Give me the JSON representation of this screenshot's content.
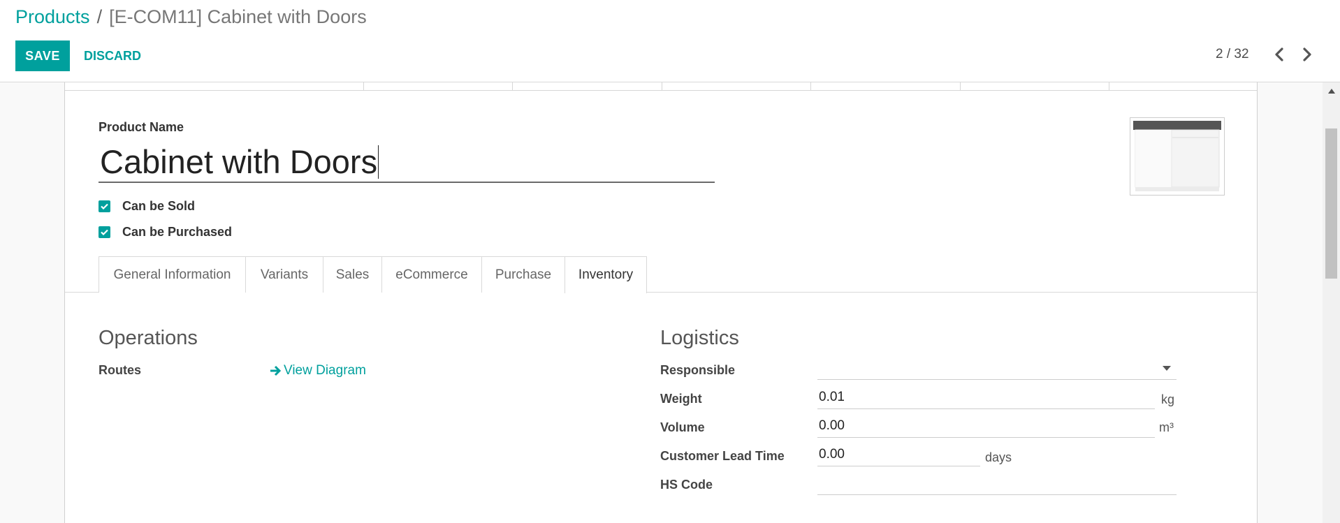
{
  "breadcrumb": {
    "parent": "Products",
    "separator": "/",
    "current": "[E-COM11] Cabinet with Doors"
  },
  "toolbar": {
    "save_label": "SAVE",
    "discard_label": "DISCARD"
  },
  "pager": {
    "value": "2 / 32"
  },
  "form": {
    "product_name_label": "Product Name",
    "product_name": "Cabinet with Doors",
    "checkboxes": [
      {
        "label": "Can be Sold",
        "checked": true
      },
      {
        "label": "Can be Purchased",
        "checked": true
      }
    ]
  },
  "tabs": [
    {
      "label": "General Information",
      "active": false
    },
    {
      "label": "Variants",
      "active": false
    },
    {
      "label": "Sales",
      "active": false
    },
    {
      "label": "eCommerce",
      "active": false
    },
    {
      "label": "Purchase",
      "active": false
    },
    {
      "label": "Inventory",
      "active": true
    }
  ],
  "operations": {
    "title": "Operations",
    "routes_label": "Routes",
    "view_diagram_label": "View Diagram"
  },
  "logistics": {
    "title": "Logistics",
    "responsible_label": "Responsible",
    "responsible_value": "",
    "weight_label": "Weight",
    "weight_value": "0.01",
    "weight_unit": "kg",
    "volume_label": "Volume",
    "volume_value": "0.00",
    "volume_unit": "m³",
    "lead_time_label": "Customer Lead Time",
    "lead_time_value": "0.00",
    "lead_time_unit": "days",
    "hs_code_label": "HS Code",
    "hs_code_value": ""
  },
  "colors": {
    "accent": "#00a09d"
  },
  "icons": {
    "prev": "chevron-left-icon",
    "next": "chevron-right-icon",
    "diagram": "arrow-right-icon",
    "dropdown": "caret-down-icon"
  }
}
